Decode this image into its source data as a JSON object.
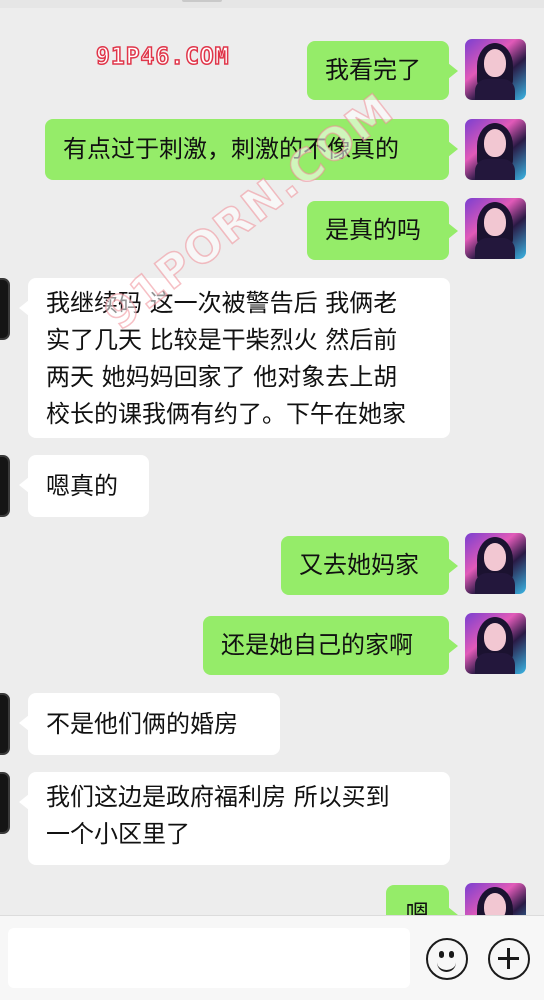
{
  "watermarks": {
    "logo": "91P46.COM",
    "diagonal": "91PORN.COM"
  },
  "messages": [
    {
      "side": "out",
      "text": "我看完了"
    },
    {
      "side": "out",
      "text": "有点过于刺激，刺激的不像真的"
    },
    {
      "side": "out",
      "text": "是真的吗"
    },
    {
      "side": "in",
      "text": "我继续码 这一次被警告后 我俩老\n实了几天 比较是干柴烈火 然后前\n两天 她妈妈回家了 他对象去上胡\n校长的课我俩有约了。下午在她家"
    },
    {
      "side": "in",
      "text": "嗯真的"
    },
    {
      "side": "out",
      "text": "又去她妈家"
    },
    {
      "side": "out",
      "text": "还是她自己的家啊"
    },
    {
      "side": "in",
      "text": "不是他们俩的婚房"
    },
    {
      "side": "in",
      "text": " 我们这边是政府福利房 所以买到\n一个小区里了"
    },
    {
      "side": "out",
      "text": "嗯"
    }
  ],
  "input_bar": {
    "text_value": "",
    "emoji_icon": "emoji-icon",
    "plus_icon": "plus-icon"
  }
}
